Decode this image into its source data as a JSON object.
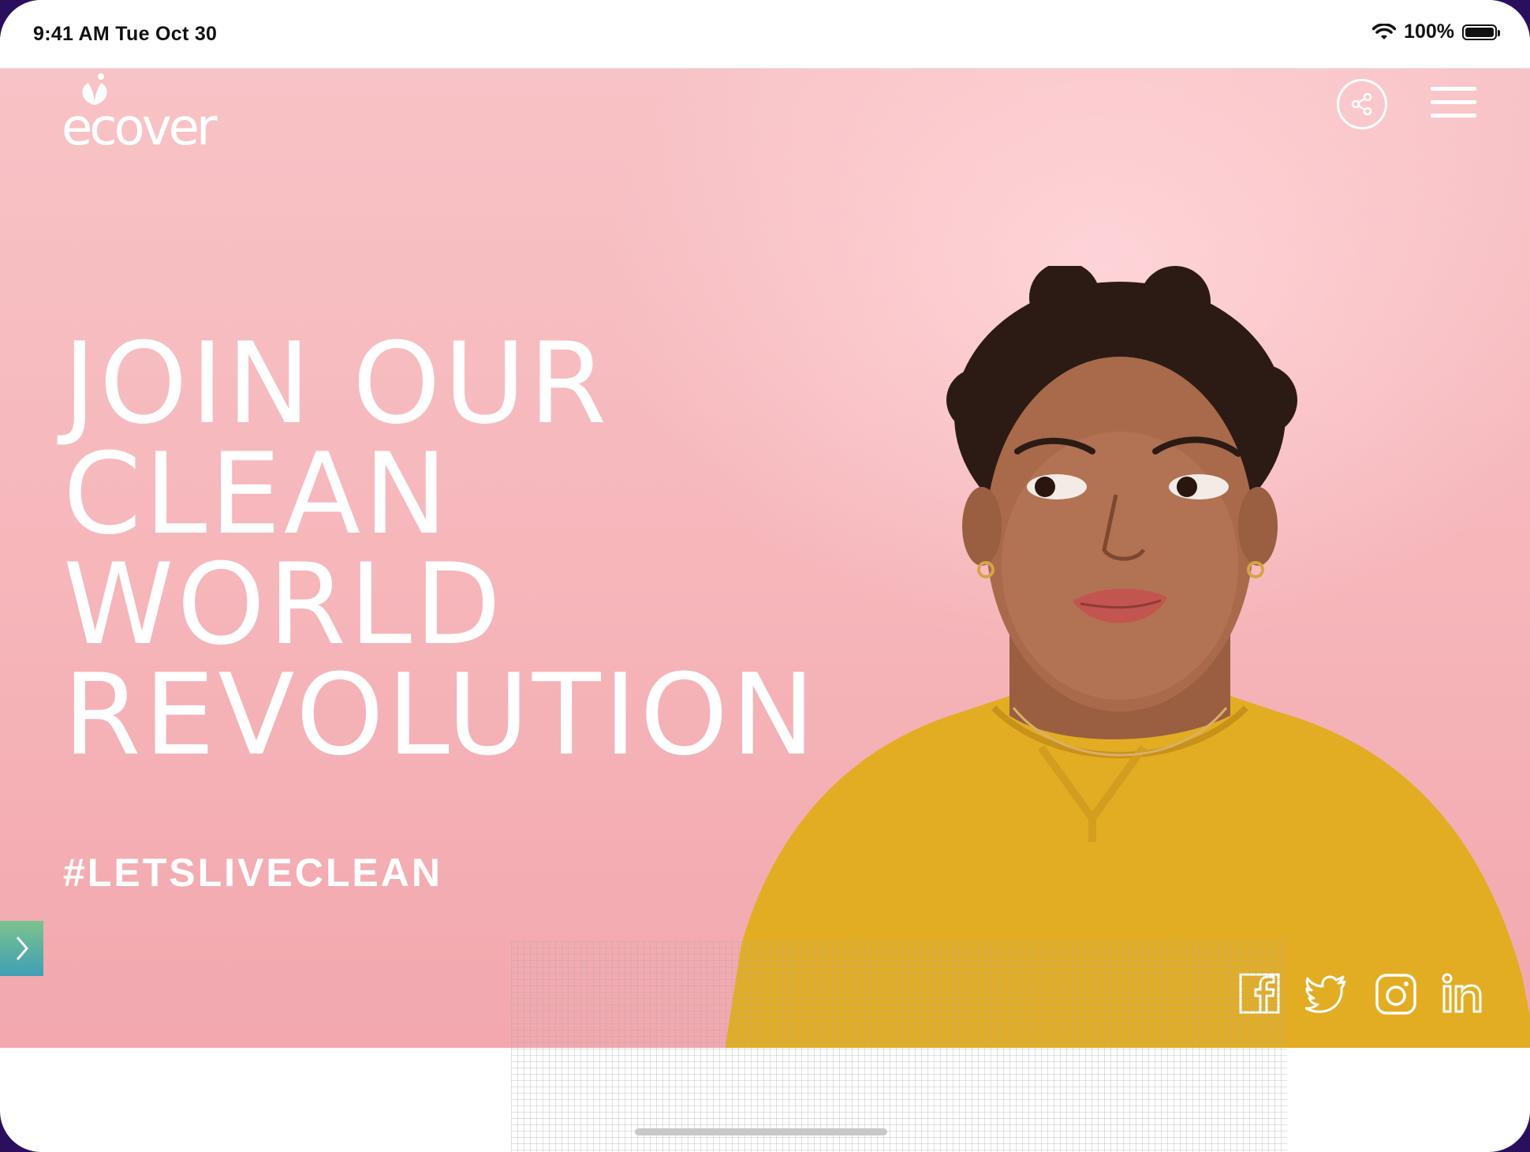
{
  "status_bar": {
    "time": "9:41 AM  Tue Oct 30",
    "battery_text": "100%",
    "battery_level": 1.0
  },
  "header": {
    "logo_text": "ecover",
    "share_icon": "share-icon",
    "menu_icon": "hamburger-menu-icon"
  },
  "hero": {
    "headline_lines": [
      "JOIN OUR",
      "CLEAN",
      "WORLD",
      "REVOLUTION"
    ],
    "hashtag": "#LETSLIVECLEAN",
    "next_icon": "chevron-right-icon"
  },
  "social": {
    "facebook_icon": "facebook-icon",
    "twitter_icon": "twitter-icon",
    "instagram_icon": "instagram-icon",
    "linkedin_icon": "linkedin-icon"
  },
  "colors": {
    "hero_pink": "#f6b8bc",
    "sweater_yellow": "#e2ad23",
    "skin": "#a86a4a",
    "hair": "#2b1b14",
    "tab_green": "#7cc38c",
    "tab_blue": "#3f9fb6"
  }
}
